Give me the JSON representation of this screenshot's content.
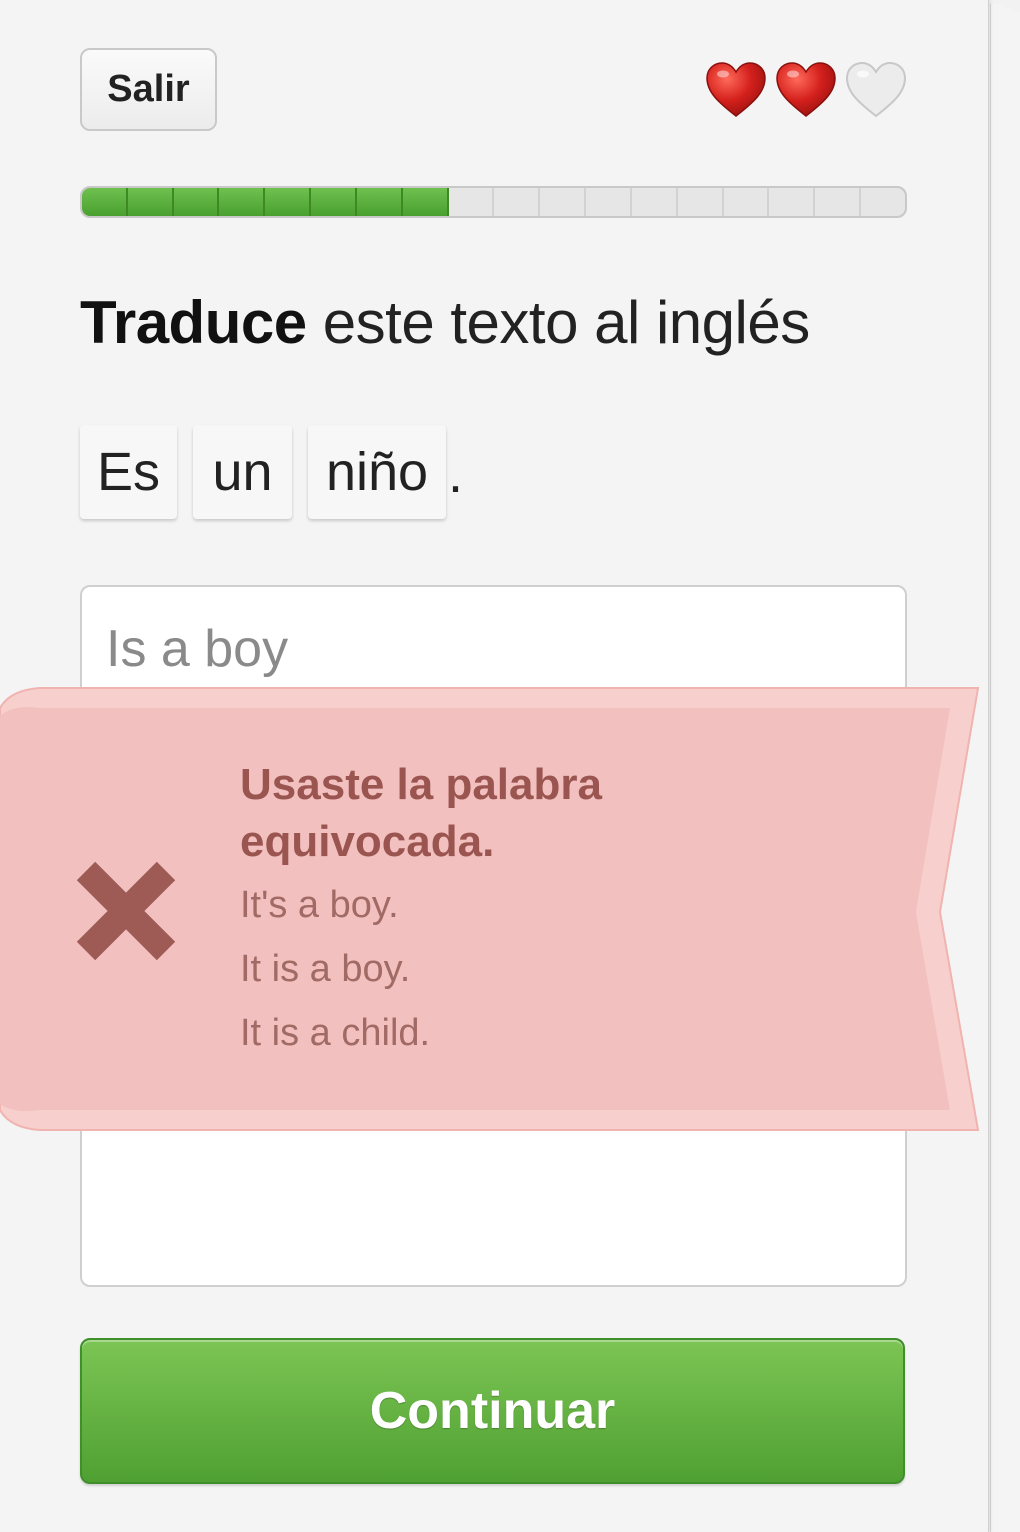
{
  "header": {
    "exit_label": "Salir",
    "hearts": [
      {
        "state": "full",
        "icon": "heart-full-icon"
      },
      {
        "state": "full",
        "icon": "heart-full-icon"
      },
      {
        "state": "empty",
        "icon": "heart-empty-icon"
      }
    ],
    "progress": {
      "filled_segments": 8,
      "total_segments": 18
    }
  },
  "prompt": {
    "instruction_bold": "Traduce",
    "instruction_rest": " este texto al inglés",
    "source_words": [
      "Es",
      "un",
      "niño"
    ],
    "source_punctuation": "."
  },
  "answer": {
    "value": "Is a boy"
  },
  "feedback": {
    "title": "Usaste la palabra equivocada.",
    "solutions": [
      "It's a boy.",
      "It is a boy.",
      "It is a child."
    ],
    "icon": "close-icon"
  },
  "footer": {
    "continue_label": "Continuar"
  },
  "colors": {
    "accent_green": "#58a73a",
    "heart_red": "#d4201c",
    "banner_bg": "#f2c1bf",
    "banner_text": "#9a5550"
  }
}
